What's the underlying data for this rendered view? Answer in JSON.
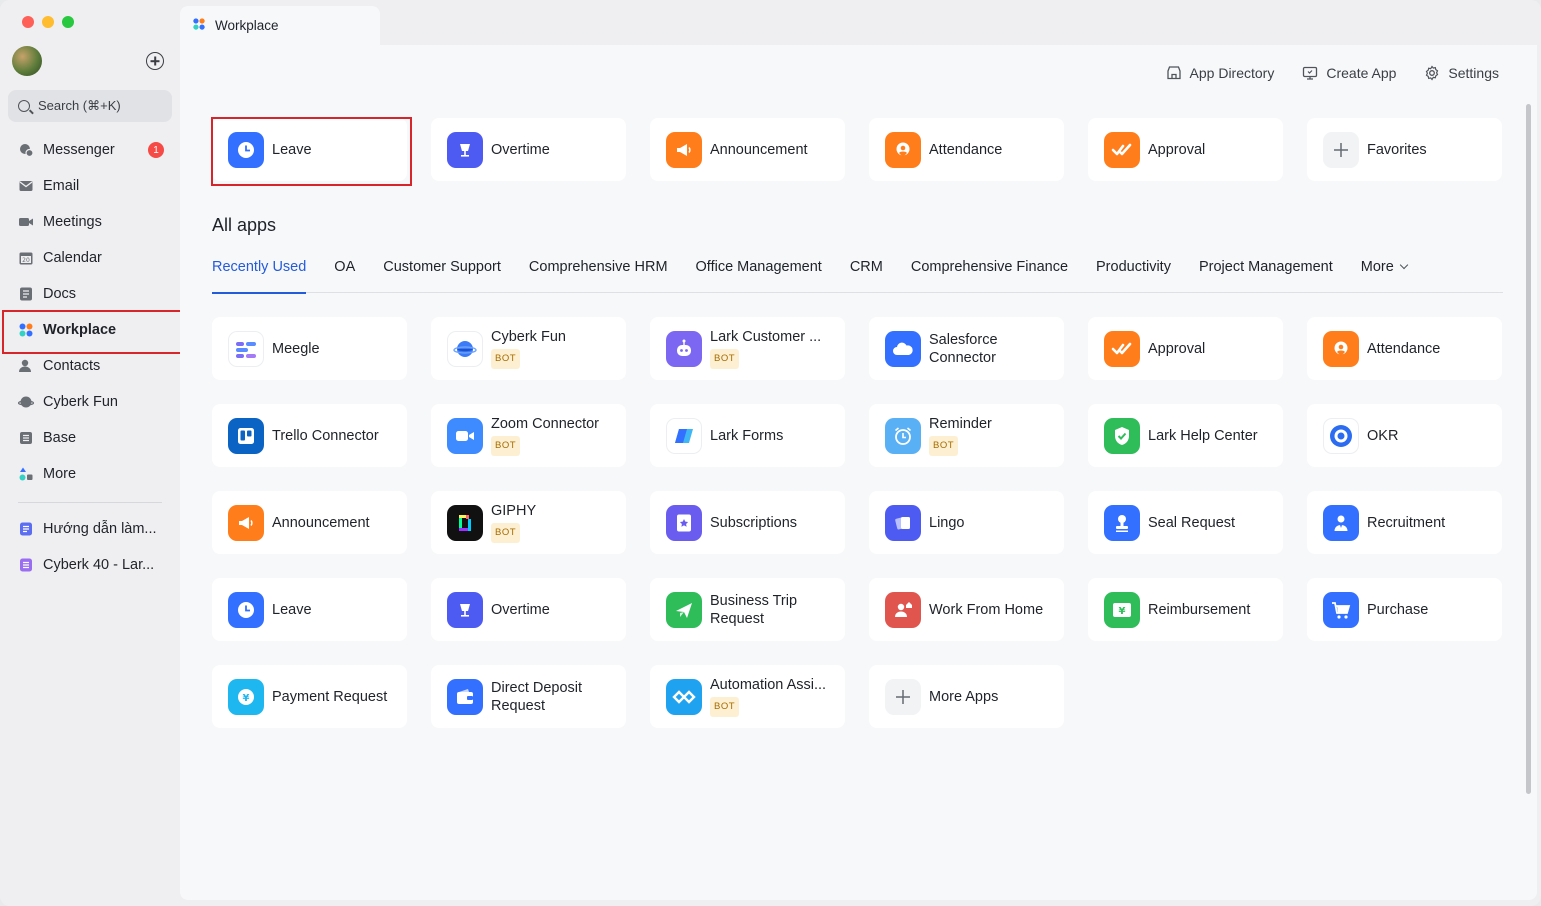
{
  "window": {
    "tab_title": "Workplace"
  },
  "sidebar": {
    "search_placeholder": "Search (⌘+K)",
    "items": [
      {
        "label": "Messenger",
        "badge": "1"
      },
      {
        "label": "Email"
      },
      {
        "label": "Meetings"
      },
      {
        "label": "Calendar"
      },
      {
        "label": "Docs"
      },
      {
        "label": "Workplace"
      },
      {
        "label": "Contacts"
      },
      {
        "label": "Cyberk Fun"
      },
      {
        "label": "Base"
      },
      {
        "label": "More"
      }
    ],
    "pinned": [
      {
        "label": "Hướng dẫn làm..."
      },
      {
        "label": "Cyberk 40 - Lar..."
      }
    ]
  },
  "toolbar": {
    "app_directory": "App Directory",
    "create_app": "Create App",
    "settings": "Settings"
  },
  "favorites": [
    {
      "label": "Leave",
      "color": "#3370ff"
    },
    {
      "label": "Overtime",
      "color": "#4e5bf2"
    },
    {
      "label": "Announcement",
      "color": "#ff7d1a"
    },
    {
      "label": "Attendance",
      "color": "#ff7d1a"
    },
    {
      "label": "Approval",
      "color": "#ff7d1a"
    },
    {
      "label": "Favorites"
    }
  ],
  "all_apps": {
    "title": "All apps",
    "categories": [
      "Recently Used",
      "OA",
      "Customer Support",
      "Comprehensive HRM",
      "Office Management",
      "CRM",
      "Comprehensive Finance",
      "Productivity",
      "Project Management",
      "More"
    ],
    "bot_label": "BOT",
    "apps": [
      {
        "label": "Meegle"
      },
      {
        "label": "Cyberk Fun",
        "bot": true
      },
      {
        "label": "Lark Customer ...",
        "bot": true
      },
      {
        "label": "Salesforce Connector"
      },
      {
        "label": "Approval"
      },
      {
        "label": "Attendance"
      },
      {
        "label": "Trello Connector"
      },
      {
        "label": "Zoom Connector",
        "bot": true
      },
      {
        "label": "Lark Forms"
      },
      {
        "label": "Reminder",
        "bot": true
      },
      {
        "label": "Lark Help Center"
      },
      {
        "label": "OKR"
      },
      {
        "label": "Announcement"
      },
      {
        "label": "GIPHY",
        "bot": true
      },
      {
        "label": "Subscriptions"
      },
      {
        "label": "Lingo"
      },
      {
        "label": "Seal Request"
      },
      {
        "label": "Recruitment"
      },
      {
        "label": "Leave"
      },
      {
        "label": "Overtime"
      },
      {
        "label": "Business Trip Request"
      },
      {
        "label": "Work From Home"
      },
      {
        "label": "Reimbursement"
      },
      {
        "label": "Purchase"
      },
      {
        "label": "Payment Request"
      },
      {
        "label": "Direct Deposit Request"
      },
      {
        "label": "Automation Assi...",
        "bot": true
      },
      {
        "label": "More Apps"
      }
    ]
  }
}
